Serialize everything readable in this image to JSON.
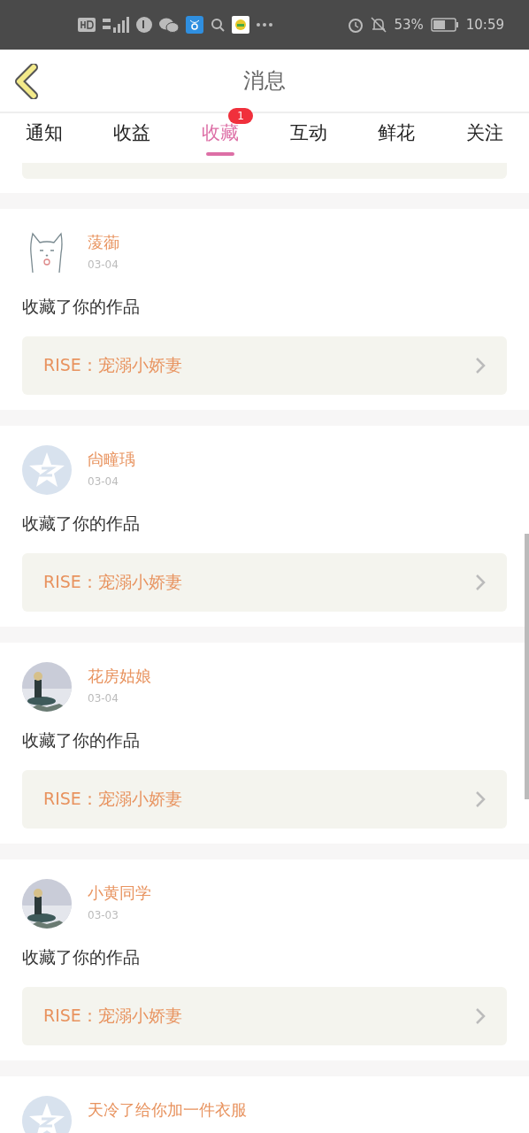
{
  "status_bar": {
    "battery_text": "53%",
    "time": "10:59"
  },
  "header": {
    "title": "消息"
  },
  "tabs": [
    {
      "label": "通知",
      "selected": false
    },
    {
      "label": "收益",
      "selected": false
    },
    {
      "label": "收藏",
      "selected": true,
      "badge": "1"
    },
    {
      "label": "互动",
      "selected": false
    },
    {
      "label": "鲜花",
      "selected": false
    },
    {
      "label": "关注",
      "selected": false
    }
  ],
  "notifications": [
    {
      "avatar": {
        "kind": "cat"
      },
      "name": "蔆蓹",
      "date": "03-04",
      "message": "收藏了你的作品",
      "work": "RISE：宠溺小娇妻"
    },
    {
      "avatar": {
        "kind": "default"
      },
      "name": "尙疃瑀",
      "date": "03-04",
      "message": "收藏了你的作品",
      "work": "RISE：宠溺小娇妻"
    },
    {
      "name": "花房姑娘",
      "date": "03-04",
      "message": "收藏了你的作品",
      "work": "RISE：宠溺小娇妻"
    },
    {
      "name": "小黄同学",
      "date": "03-03",
      "message": "收藏了你的作品",
      "work": "RISE：宠溺小娇妻"
    },
    {
      "avatar": {
        "kind": "default"
      },
      "name": "天冷了给你加一件衣服"
    }
  ]
}
